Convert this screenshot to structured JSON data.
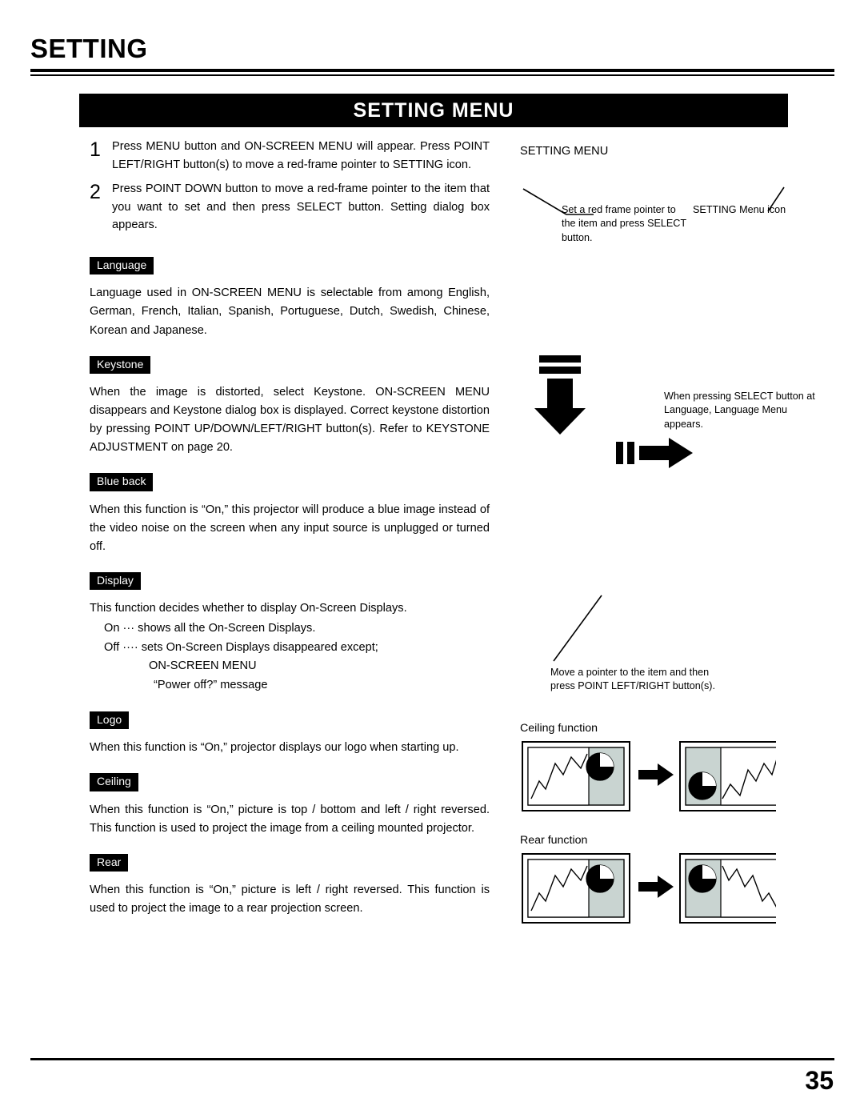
{
  "header": {
    "title": "SETTING"
  },
  "banner": {
    "title": "SETTING MENU"
  },
  "steps": [
    {
      "num": "1",
      "text": "Press MENU button and ON-SCREEN MENU will appear.  Press POINT LEFT/RIGHT button(s) to move a red-frame pointer to SETTING icon."
    },
    {
      "num": "2",
      "text": "Press POINT DOWN button to move a red-frame pointer to the item that you want to set and then press SELECT button.  Setting dialog box appears."
    }
  ],
  "sections": [
    {
      "label": "Language",
      "body": "Language used in ON-SCREEN MENU is selectable from among English, German, French, Italian, Spanish, Portuguese, Dutch, Swedish, Chinese, Korean and Japanese."
    },
    {
      "label": "Keystone",
      "body": "When the image is distorted, select Keystone.  ON-SCREEN MENU disappears and Keystone dialog box is displayed.  Correct keystone distortion by pressing POINT UP/DOWN/LEFT/RIGHT button(s).  Refer to KEYSTONE ADJUSTMENT on page 20."
    },
    {
      "label": "Blue back",
      "body": "When this function is “On,” this projector will produce a blue image instead of the video noise on the screen when any input source is unplugged or turned off."
    },
    {
      "label": "Display",
      "body": "This function decides whether to display On-Screen Displays."
    },
    {
      "label": "Logo",
      "body": "When this function is “On,” projector displays our logo when starting up."
    },
    {
      "label": "Ceiling",
      "body": "When this function is “On,” picture is top / bottom and left / right reversed.  This function is used to project the image from a ceiling mounted projector."
    },
    {
      "label": "Rear",
      "body": "When this function is “On,” picture is left / right reversed.  This function is used to project the image to a rear projection screen."
    }
  ],
  "display_list": {
    "on": "On  ···  shows all the On-Screen Displays.",
    "off": "Off ····  sets On-Screen Displays disappeared except;",
    "off_item1": "ON-SCREEN MENU",
    "off_item2": "“Power off?” message"
  },
  "right": {
    "menu_title": "SETTING MENU",
    "callout_red_frame": "Set a red frame pointer to the item and press SELECT button.",
    "callout_menu_icon": "SETTING Menu icon",
    "callout_select": "When pressing SELECT button at Language, Language Menu appears.",
    "callout_pointer": "Move a pointer to the item and then press POINT LEFT/RIGHT button(s).",
    "caption_ceiling": "Ceiling function",
    "caption_rear": "Rear function"
  },
  "footer": {
    "page_number": "35"
  }
}
